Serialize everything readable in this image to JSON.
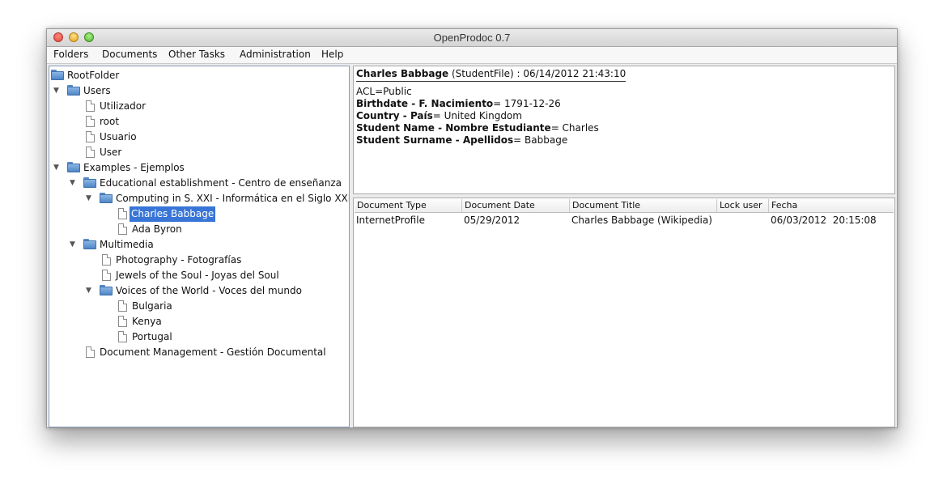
{
  "window": {
    "title": "OpenProdoc 0.7"
  },
  "menubar": {
    "items": [
      "Folders",
      "Documents",
      "Other Tasks",
      "Administration",
      "Help"
    ]
  },
  "tree": {
    "nodes": [
      {
        "label": "RootFolder",
        "type": "folder",
        "expanded": false
      },
      {
        "label": "Users",
        "type": "folder",
        "expanded": true
      },
      {
        "label": "Utilizador",
        "type": "document"
      },
      {
        "label": "root",
        "type": "document"
      },
      {
        "label": "Usuario",
        "type": "document"
      },
      {
        "label": "User",
        "type": "document"
      },
      {
        "label": "Examples - Ejemplos",
        "type": "folder",
        "expanded": true
      },
      {
        "label": "Educational establishment - Centro de enseñanza",
        "type": "folder",
        "expanded": true
      },
      {
        "label": "Computing in S. XXI - Informática en el Siglo XXI",
        "type": "folder",
        "expanded": true
      },
      {
        "label": "Charles Babbage",
        "type": "document",
        "selected": true
      },
      {
        "label": "Ada Byron",
        "type": "document"
      },
      {
        "label": "Multimedia",
        "type": "folder",
        "expanded": true
      },
      {
        "label": "Photography - Fotografías",
        "type": "document"
      },
      {
        "label": "Jewels of the Soul - Joyas del Soul",
        "type": "document"
      },
      {
        "label": "Voices of the World - Voces del mundo",
        "type": "folder",
        "expanded": true
      },
      {
        "label": "Bulgaria",
        "type": "document"
      },
      {
        "label": "Kenya",
        "type": "document"
      },
      {
        "label": "Portugal",
        "type": "document"
      },
      {
        "label": "Document Management -  Gestión Documental",
        "type": "document"
      }
    ]
  },
  "info": {
    "header_name": "Charles Babbage",
    "header_rest": " (StudentFile) : 06/14/2012 21:43:10",
    "acl": "ACL=Public",
    "fields": [
      {
        "label": "Birthdate - F. Nacimiento",
        "value": "= 1791-12-26"
      },
      {
        "label": "Country - País",
        "value": "= United Kingdom"
      },
      {
        "label": "Student Name - Nombre Estudiante",
        "value": "= Charles"
      },
      {
        "label": "Student Surname - Apellidos",
        "value": "= Babbage"
      }
    ]
  },
  "table": {
    "columns": [
      "Document Type",
      "Document Date",
      "Document Title",
      "Lock user",
      "Fecha"
    ],
    "rows": [
      [
        "InternetProfile",
        "05/29/2012",
        "Charles Babbage (Wikipedia)",
        "",
        "06/03/2012  20:15:08"
      ]
    ]
  },
  "colors": {
    "selection": "#3875d7",
    "folder": "#6fa2dc"
  }
}
